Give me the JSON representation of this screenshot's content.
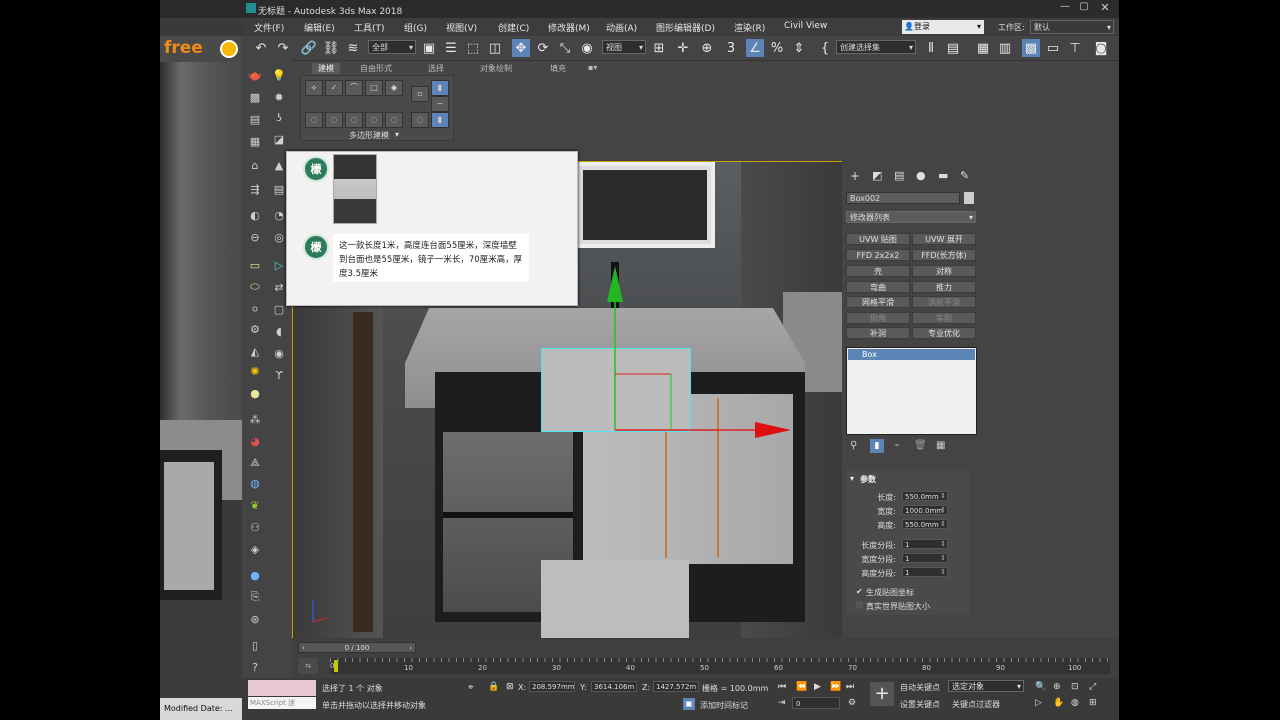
{
  "window": {
    "title": "无标题 - Autodesk 3ds Max 2018"
  },
  "menu": [
    "文件(F)",
    "编辑(E)",
    "工具(T)",
    "组(G)",
    "视图(V)",
    "创建(C)",
    "修改器(M)",
    "动画(A)",
    "图形编辑器(D)",
    "渲染(R)",
    "Civil View"
  ],
  "login": {
    "label": "登录"
  },
  "workspace": {
    "label": "工作区:",
    "value": "默认"
  },
  "toolbar": {
    "filter": "全部",
    "ref_coord": "视图",
    "selection_set": "创建选择集"
  },
  "ribbon": {
    "tabs": [
      "建模",
      "自由形式",
      "选择",
      "对象绘制",
      "填充"
    ],
    "panel_label": "多边形建模"
  },
  "left_strip": {
    "logo": "free"
  },
  "chat": {
    "message": "这一款长度1米，高度连台面55厘米，深度墙壁到台面也是55厘米，镜子一米长，70厘米高，厚度3.5厘米",
    "avatar_char": "檬"
  },
  "command_panel": {
    "object_name": "Box002",
    "modifier_list": "修改器列表",
    "buttons": [
      {
        "label": "UVW 贴图",
        "dim": false
      },
      {
        "label": "UVW 展开",
        "dim": false
      },
      {
        "label": "FFD 2x2x2",
        "dim": false
      },
      {
        "label": "FFD(长方体)",
        "dim": false
      },
      {
        "label": "壳",
        "dim": false
      },
      {
        "label": "对称",
        "dim": false
      },
      {
        "label": "弯曲",
        "dim": false
      },
      {
        "label": "推力",
        "dim": false
      },
      {
        "label": "网格平滑",
        "dim": false
      },
      {
        "label": "涡轮平滑",
        "dim": true
      },
      {
        "label": "倒角",
        "dim": true
      },
      {
        "label": "车削",
        "dim": true
      },
      {
        "label": "补洞",
        "dim": false
      },
      {
        "label": "专业优化",
        "dim": false
      }
    ],
    "stack_item": "Box",
    "rollout_title": "参数",
    "params": [
      {
        "label": "长度:",
        "value": "550.0mm"
      },
      {
        "label": "宽度:",
        "value": "1000.0mm"
      },
      {
        "label": "高度:",
        "value": "550.0mm"
      },
      {
        "label": "长度分段:",
        "value": "1"
      },
      {
        "label": "宽度分段:",
        "value": "1"
      },
      {
        "label": "高度分段:",
        "value": "1"
      }
    ],
    "checkboxes": [
      {
        "label": "生成贴图坐标",
        "checked": true
      },
      {
        "label": "真实世界贴图大小",
        "checked": false
      }
    ]
  },
  "timeline": {
    "frame": "0 / 100",
    "ticks": [
      "0",
      "10",
      "20",
      "30",
      "40",
      "50",
      "60",
      "70",
      "80",
      "90",
      "100"
    ]
  },
  "status": {
    "maxscript": "MAXScript 迷",
    "selected": "选择了 1 个 对象",
    "hint": "单击并拖动以选择并移动对象",
    "x": "208.597mm",
    "y": "3614.106m",
    "z": "1427.572m",
    "grid": "栅格 = 100.0mm",
    "add_time_tag": "添加时间标记",
    "auto_key": "自动关键点",
    "set_key": "设置关键点",
    "selected_obj": "选定对象",
    "key_filters": "关键点过滤器",
    "frame_field": "0"
  },
  "taskbar": {
    "modified": "Modified Date: ..."
  }
}
